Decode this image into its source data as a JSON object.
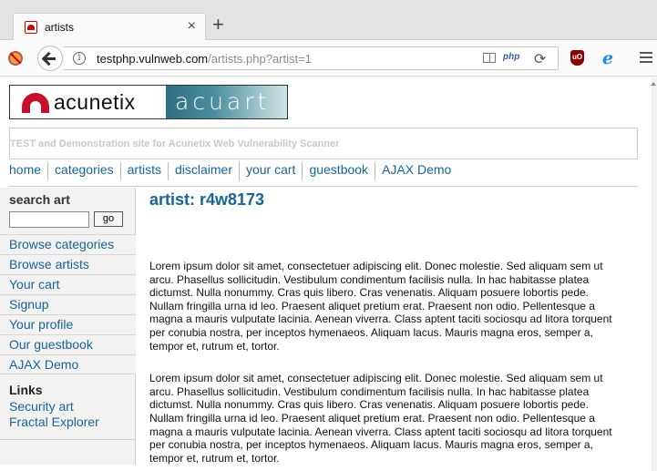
{
  "browser": {
    "tab_title": "artists",
    "tab_close": "×",
    "new_tab": "+",
    "url_host": "testphp.vulnweb.com",
    "url_path": "/artists.php?artist=1",
    "php_badge": "php",
    "reload_glyph": "⟳",
    "ublock_label": "uO",
    "ie_glyph": "e"
  },
  "site": {
    "logo_left": "acunetix",
    "logo_right": "acuart",
    "tagline": "TEST and Demonstration site for Acunetix Web Vulnerability Scanner",
    "topnav": [
      "home",
      "categories",
      "artists",
      "disclaimer",
      "your cart",
      "guestbook",
      "AJAX Demo"
    ]
  },
  "sidebar": {
    "search_title": "search art",
    "search_value": "",
    "go_label": "go",
    "links": [
      "Browse categories",
      "Browse artists",
      "Your cart",
      "Signup",
      "Your profile",
      "Our guestbook",
      "AJAX Demo"
    ],
    "links_title": "Links",
    "extra_links": [
      "Security art",
      "Fractal Explorer"
    ]
  },
  "main": {
    "title": "artist: r4w8173",
    "paragraphs": [
      "Lorem ipsum dolor sit amet, consectetuer adipiscing elit. Donec molestie. Sed aliquam sem ut arcu. Phasellus sollicitudin. Vestibulum condimentum facilisis nulla. In hac habitasse platea dictumst. Nulla nonummy. Cras quis libero. Cras venenatis. Aliquam posuere lobortis pede. Nullam fringilla urna id leo. Praesent aliquet pretium erat. Praesent non odio. Pellentesque a magna a mauris vulputate lacinia. Aenean viverra. Class aptent taciti sociosqu ad litora torquent per conubia nostra, per inceptos hymenaeos. Aliquam lacus. Mauris magna eros, semper a, tempor et, rutrum et, tortor.",
      "Lorem ipsum dolor sit amet, consectetuer adipiscing elit. Donec molestie. Sed aliquam sem ut arcu. Phasellus sollicitudin. Vestibulum condimentum facilisis nulla. In hac habitasse platea dictumst. Nulla nonummy. Cras quis libero. Cras venenatis. Aliquam posuere lobortis pede. Nullam fringilla urna id leo. Praesent aliquet pretium erat. Praesent non odio. Pellentesque a magna a mauris vulputate lacinia. Aenean viverra. Class aptent taciti sociosqu ad litora torquent per conubia nostra, per inceptos hymenaeos. Aliquam lacus. Mauris magna eros, semper a, tempor et, rutrum et, tortor."
    ]
  },
  "colors": {
    "link": "#1a6496",
    "brand_red": "#c8102e",
    "tagline": "#c8c8c8"
  }
}
